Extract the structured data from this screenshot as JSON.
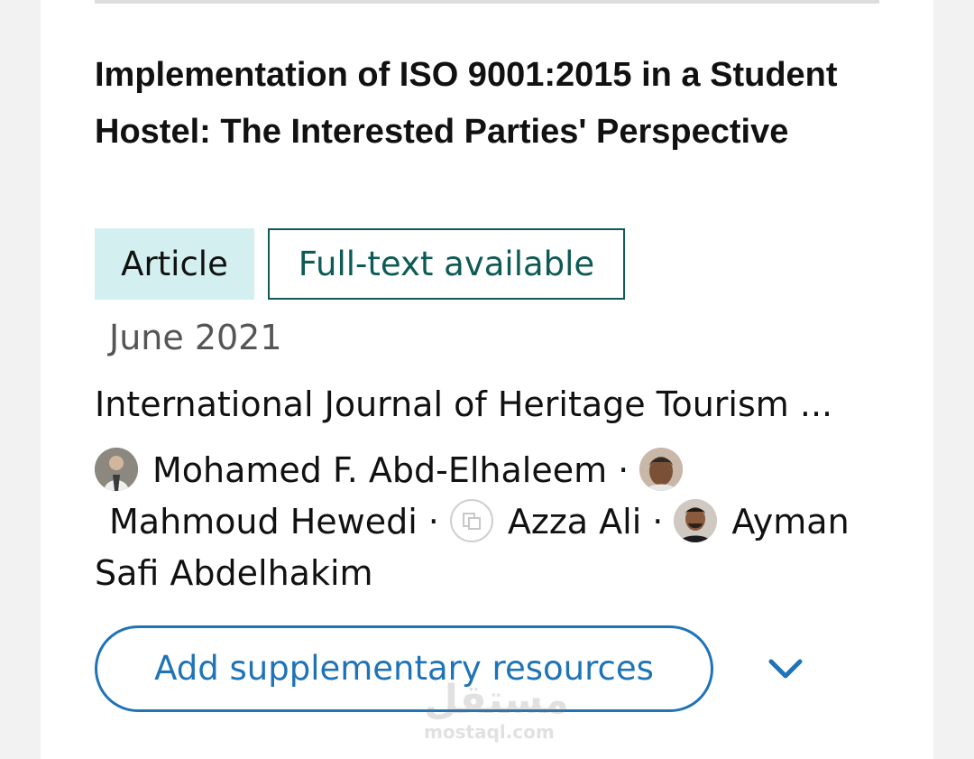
{
  "publication": {
    "title": "Implementation of ISO 9001:2015 in a Student Hostel: The Interested Parties' Perspective",
    "badges": {
      "type": "Article",
      "availability": "Full-text available"
    },
    "date": "June 2021",
    "journal": "International Journal of Heritage Tourism ...",
    "authors": [
      {
        "name": "Mohamed F. Abd-Elhaleem",
        "avatar_icon": "author-photo-icon"
      },
      {
        "name": "Mahmoud Hewedi",
        "avatar_icon": "author-photo-icon"
      },
      {
        "name": "Azza Ali",
        "avatar_icon": "placeholder-avatar-icon"
      },
      {
        "name": "Ayman Safi Abdelhakim",
        "avatar_icon": "author-photo-icon"
      }
    ],
    "separator": "·"
  },
  "actions": {
    "add_supplementary_label": "Add supplementary resources",
    "expand_icon": "chevron-down-icon"
  },
  "watermark": {
    "arabic": "مستقل",
    "latin": "mostaql.com"
  },
  "colors": {
    "accent_blue": "#1f73b7",
    "teal_dark": "#0d5a56",
    "badge_bg": "#d3efef"
  }
}
